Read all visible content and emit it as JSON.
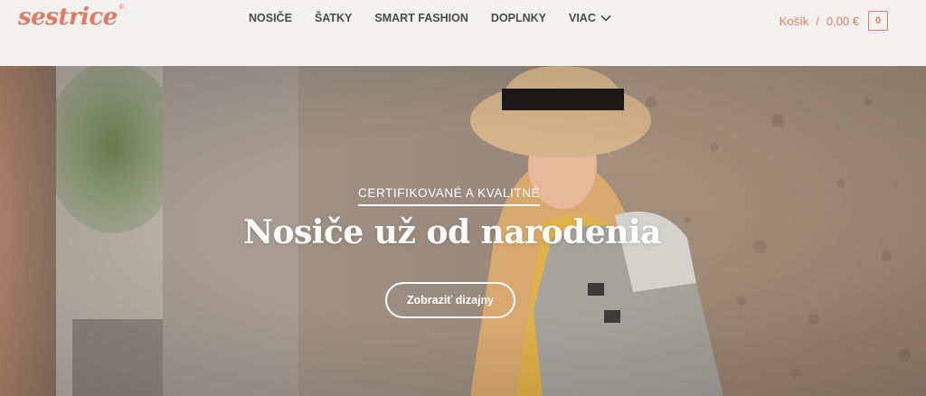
{
  "brand": {
    "name": "sestrice",
    "mark": "®",
    "color": "#e07b61"
  },
  "nav": {
    "items": [
      {
        "label": "NOSIČE"
      },
      {
        "label": "ŠATKY"
      },
      {
        "label": "SMART FASHION"
      },
      {
        "label": "DOPLNKY"
      },
      {
        "label": "VIAC",
        "icon": "chevron-down-icon"
      }
    ]
  },
  "cart": {
    "label": "Košík",
    "separator": "/",
    "amount": "0,00 €",
    "count": "0",
    "icon": "cart-count-icon"
  },
  "hero": {
    "eyebrow": "CERTIFIKOVANÉ A KVALITNÉ",
    "headline": "Nosiče už od narodenia",
    "button_label": "Zobraziť dizajny"
  }
}
